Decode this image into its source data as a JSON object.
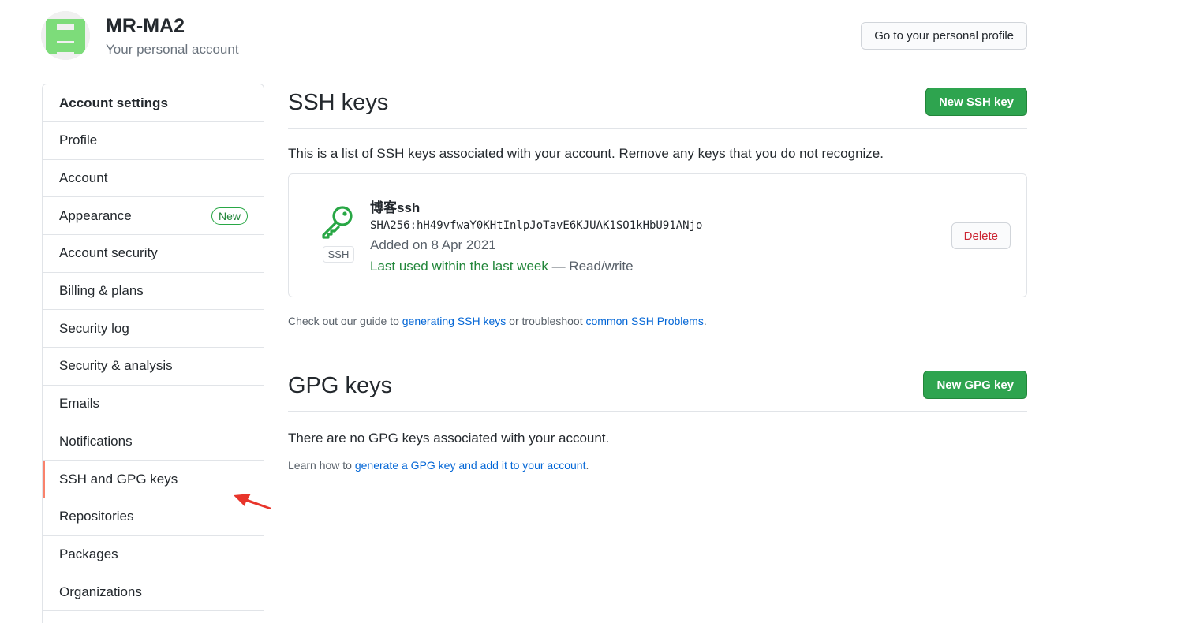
{
  "header": {
    "account_name": "MR-MA2",
    "account_sub": "Your personal account",
    "profile_button": "Go to your personal profile"
  },
  "sidebar": {
    "title": "Account settings",
    "items": [
      {
        "label": "Profile"
      },
      {
        "label": "Account"
      },
      {
        "label": "Appearance",
        "badge": "New"
      },
      {
        "label": "Account security"
      },
      {
        "label": "Billing & plans"
      },
      {
        "label": "Security log"
      },
      {
        "label": "Security & analysis"
      },
      {
        "label": "Emails"
      },
      {
        "label": "Notifications"
      },
      {
        "label": "SSH and GPG keys",
        "selected": true
      },
      {
        "label": "Repositories"
      },
      {
        "label": "Packages"
      },
      {
        "label": "Organizations"
      }
    ]
  },
  "ssh": {
    "title": "SSH keys",
    "new_button": "New SSH key",
    "description": "This is a list of SSH keys associated with your account. Remove any keys that you do not recognize.",
    "key": {
      "type_label": "SSH",
      "title": "博客ssh",
      "fingerprint": "SHA256:hH49vfwaY0KHtInlpJoTavE6KJUAK1SO1kHbU91ANjo",
      "added": "Added on 8 Apr 2021",
      "last_used": "Last used within the last week",
      "access": " — Read/write",
      "delete_button": "Delete"
    },
    "guide": {
      "prefix": "Check out our guide to ",
      "link1": "generating SSH keys",
      "middle": " or troubleshoot ",
      "link2": "common SSH Problems",
      "suffix": "."
    }
  },
  "gpg": {
    "title": "GPG keys",
    "new_button": "New GPG key",
    "none_text": "There are no GPG keys associated with your account.",
    "learn_prefix": "Learn how to ",
    "learn_link": "generate a GPG key and add it to your account",
    "learn_suffix": "."
  },
  "colors": {
    "green_button": "#2ea44f",
    "selected_indicator": "#f9826c",
    "annotation_arrow": "#e8352b",
    "link": "#0366d6",
    "avatar_green": "#7ddc7a"
  },
  "icons": {
    "avatar": "identicon-avatar",
    "key": "key-icon",
    "annotation": "red-arrow-annotation"
  }
}
